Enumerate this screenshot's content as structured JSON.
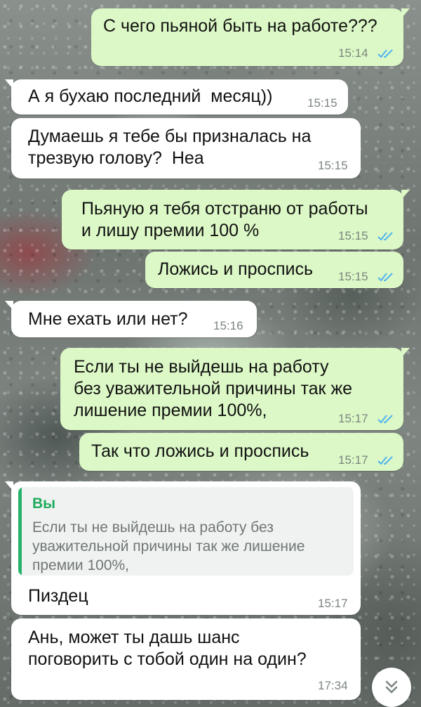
{
  "messages": [
    {
      "text": "С чего пьяной быть на работе???",
      "time": "15:14"
    },
    {
      "text": "А я бухаю последний  месяц))",
      "time": "15:15"
    },
    {
      "text": "Думаешь я тебе бы призналась на\nтрезвую голову?  Неа",
      "time": "15:15"
    },
    {
      "text": "Пьяную я тебя отстраню от работы\nи лишу премии 100 %",
      "time": "15:15"
    },
    {
      "text": "Ложись и проспись",
      "time": "15:15"
    },
    {
      "text": "Мне ехать или нет?",
      "time": "15:16"
    },
    {
      "text": "Если ты не выйдешь на работу\nбез уважительной причины так же\nлишение премии 100%,",
      "time": "15:17"
    },
    {
      "text": "Так что ложись и проспись",
      "time": "15:17"
    },
    {
      "quote": {
        "author": "Вы",
        "text": "Если ты не выйдешь на работу без\nуважительной причины так же лишение\nпремии 100%,"
      },
      "text": "Пиздец",
      "time": "15:17"
    },
    {
      "text": "Ань, может ты дашь шанс\nпоговорить с тобой один на один?",
      "time": "17:34"
    }
  ],
  "icons": {
    "read_receipt": "double-check-icon",
    "scroll_down": "chevron-double-down-icon"
  },
  "colors": {
    "outgoing_bubble": "#dcf8c6",
    "incoming_bubble": "#ffffff",
    "read_tick": "#4fb3f0",
    "quote_accent": "#25b36b"
  }
}
